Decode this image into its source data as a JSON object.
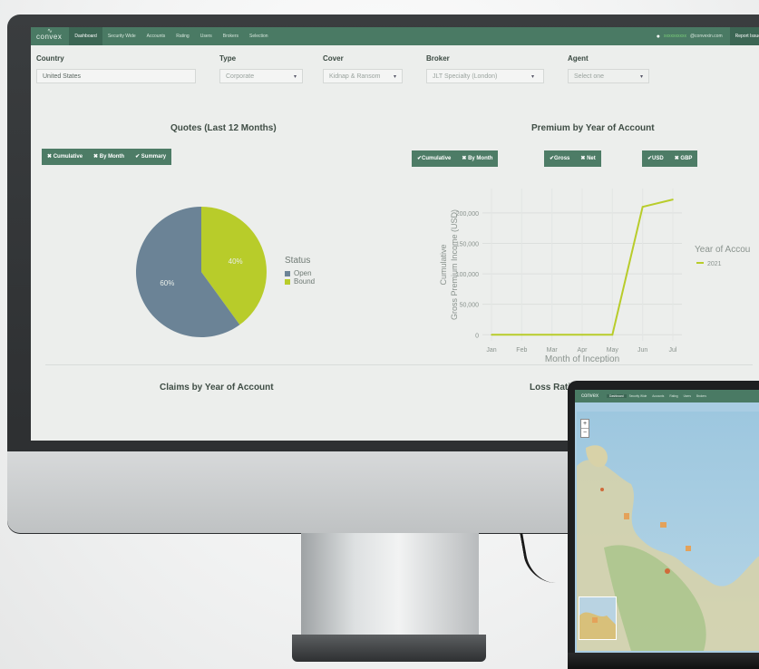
{
  "nav": {
    "logo": "convex",
    "items": [
      "Dashboard",
      "Security Wide",
      "Accounts",
      "Rating",
      "Users",
      "Brokers",
      "Selection"
    ],
    "active": "Dashboard",
    "user_email": "xxxxxxxxxx",
    "user_domain": "@convexin.com",
    "report_issue": "Report Issue"
  },
  "filters": {
    "country": {
      "label": "Country",
      "value": "United States"
    },
    "type": {
      "label": "Type",
      "value": "Corporate"
    },
    "cover": {
      "label": "Cover",
      "value": "Kidnap & Ransom"
    },
    "broker": {
      "label": "Broker",
      "value": "JLT Specialty (London)"
    },
    "agent": {
      "label": "Agent",
      "placeholder": "Select one"
    }
  },
  "quotes": {
    "title": "Quotes (Last 12 Months)",
    "buttons": [
      {
        "icon": "✖",
        "label": "Cumulative"
      },
      {
        "icon": "✖",
        "label": "By Month"
      },
      {
        "icon": "✔",
        "label": "Summary"
      }
    ]
  },
  "premium": {
    "title": "Premium by Year of Account",
    "groups": [
      [
        {
          "icon": "✔",
          "label": "Cumulative"
        },
        {
          "icon": "✖",
          "label": "By Month"
        }
      ],
      [
        {
          "icon": "✔",
          "label": "Gross"
        },
        {
          "icon": "✖",
          "label": "Net"
        }
      ],
      [
        {
          "icon": "✔",
          "label": "USD"
        },
        {
          "icon": "✖",
          "label": "GBP"
        }
      ]
    ]
  },
  "claims_title": "Claims by Year of Account",
  "loss_title": "Loss Rati",
  "colors": {
    "nav": "#4a7a64",
    "open": "#6b8396",
    "bound": "#b8cc2a"
  },
  "chart_data": [
    {
      "type": "pie",
      "labels": [
        "Open",
        "Bound"
      ],
      "values": [
        60,
        40
      ],
      "slice_labels": [
        "60%",
        "40%"
      ],
      "legend_title": "Status",
      "legend_position": "right"
    },
    {
      "type": "line",
      "x": [
        "Jan",
        "Feb",
        "Mar",
        "Apr",
        "May",
        "Jun",
        "Jul"
      ],
      "series": [
        {
          "name": "2021",
          "values": [
            0,
            0,
            0,
            0,
            0,
            210000,
            222000
          ]
        }
      ],
      "ylabel": "Cumulative\nGross Premium Income (USD)",
      "ylabel_line1": "Cumulative",
      "ylabel_line2": "Gross Premium Income (USD)",
      "xlabel": "Month of Inception",
      "yticks": [
        "0",
        "50,000",
        "100,000",
        "150,000",
        "200,000"
      ],
      "ylim": [
        -10000,
        240000
      ],
      "legend_title": "Year of Accou",
      "grid": true,
      "legend_position": "right"
    }
  ],
  "laptop": {
    "logo": "convex",
    "nav_items": [
      "Dashboard",
      "Security Wide",
      "Accounts",
      "Rating",
      "Users",
      "Brokers"
    ],
    "zoom_in": "+",
    "zoom_out": "−"
  }
}
